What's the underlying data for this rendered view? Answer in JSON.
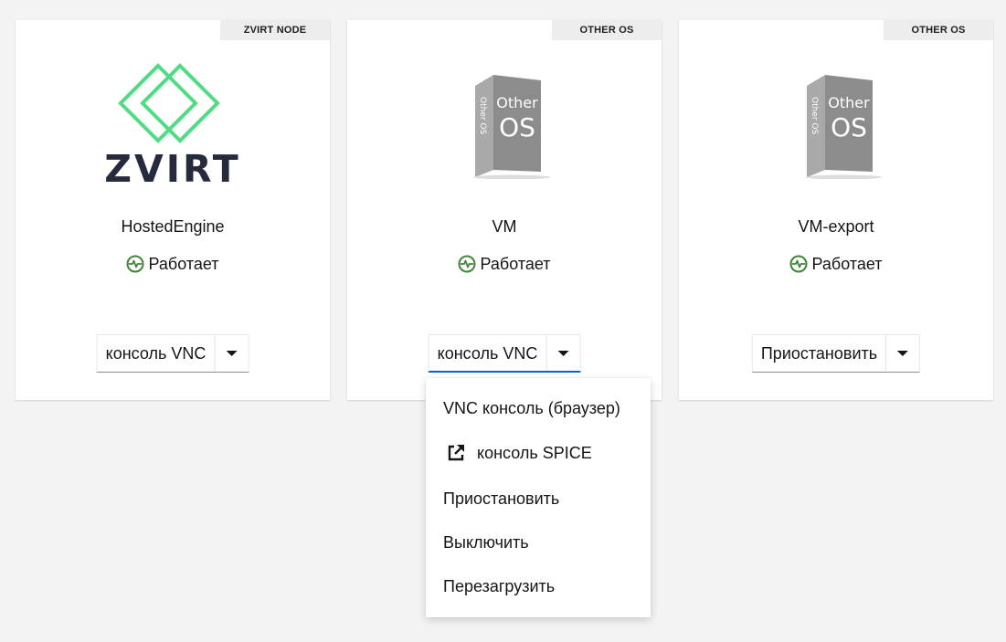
{
  "cards": [
    {
      "badge": "ZVIRT NODE",
      "image": "zvirt-logo",
      "logo_text": "ZVIRT",
      "name": "HostedEngine",
      "status": "Работает",
      "status_icon": "heartbeat-icon",
      "button_label": "консоль VNC"
    },
    {
      "badge": "OTHER OS",
      "image": "other-os-box",
      "name": "VM",
      "status": "Работает",
      "status_icon": "heartbeat-icon",
      "button_label": "консоль VNC"
    },
    {
      "badge": "OTHER OS",
      "image": "other-os-box",
      "name": "VM-export",
      "status": "Работает",
      "status_icon": "heartbeat-icon",
      "button_label": "Приостановить"
    }
  ],
  "box_art": {
    "front_line1": "Other",
    "front_line2": "OS",
    "side_text": "Other OS"
  },
  "dropdown": {
    "items": [
      {
        "label": "VNC консоль (браузер)"
      },
      {
        "label": "консоль SPICE",
        "icon": "external-link-icon"
      },
      {
        "label": "Приостановить"
      },
      {
        "label": "Выключить"
      },
      {
        "label": "Перезагрузить"
      }
    ]
  },
  "colors": {
    "background": "#f3f3f3",
    "status_green": "#3e8635",
    "logo_green": "#4fdc84",
    "logo_navy": "#262a3d",
    "active_underline": "#0066cc"
  }
}
